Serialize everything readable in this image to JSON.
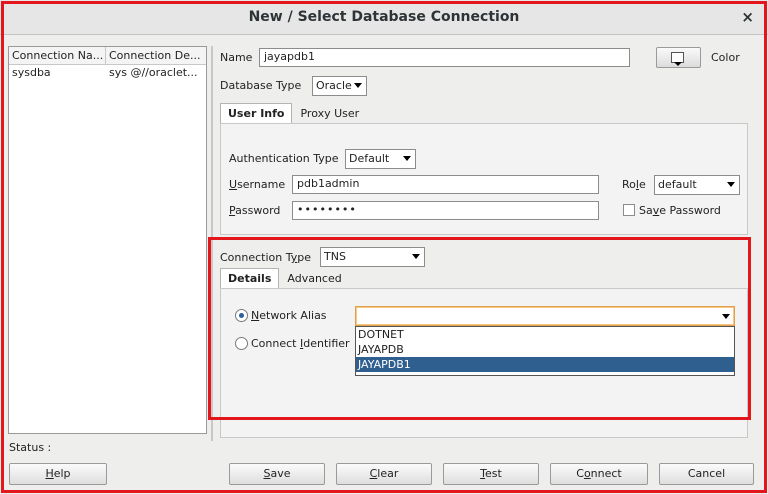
{
  "window": {
    "title": "New / Select Database Connection",
    "close_glyph": "×"
  },
  "connections": {
    "headers": [
      "Connection Na...",
      "Connection De..."
    ],
    "rows": [
      {
        "name": "sysdba",
        "details": "sys @//oraclet..."
      }
    ]
  },
  "form": {
    "name_label": "Name",
    "name_value": "jayapdb1",
    "color_label": "Color",
    "db_type_label": "Database Type",
    "db_type_value": "Oracle",
    "tabs": [
      "User Info",
      "Proxy User"
    ],
    "auth_type_label": "Authentication Type",
    "auth_type_value": "Default",
    "username_label_u": "U",
    "username_label_rest": "sername",
    "username_value": "pdb1admin",
    "password_label_u": "P",
    "password_label_rest": "assword",
    "password_value": "••••••••",
    "role_label_pre": "Ro",
    "role_label_u": "l",
    "role_label_rest": "e",
    "role_value": "default",
    "save_password_pre": "Sa",
    "save_password_u": "v",
    "save_password_rest": "e Password"
  },
  "connection": {
    "type_label_pre": "Connection T",
    "type_label_u": "y",
    "type_label_rest": "pe",
    "type_value": "TNS",
    "tabs": [
      "Details",
      "Advanced"
    ],
    "network_alias_pre": "",
    "network_alias_u": "N",
    "network_alias_rest": "etwork Alias",
    "connect_identifier_pre": "Connect ",
    "connect_identifier_u": "I",
    "connect_identifier_rest": "dentifier",
    "network_alias_value": "",
    "alias_options": [
      "DOTNET",
      "JAYAPDB",
      "JAYAPDB1"
    ],
    "selected_option": "JAYAPDB1"
  },
  "status": {
    "label": "Status :"
  },
  "buttons": {
    "help_u": "H",
    "help_rest": "elp",
    "save_u": "S",
    "save_rest": "ave",
    "clear_u": "C",
    "clear_rest": "lear",
    "test_u": "T",
    "test_rest": "est",
    "connect_pre": "C",
    "connect_u": "o",
    "connect_rest": "nnect",
    "cancel": "Cancel"
  },
  "colors": {
    "highlight": "#e3161c",
    "selection": "#2f5f8f"
  }
}
